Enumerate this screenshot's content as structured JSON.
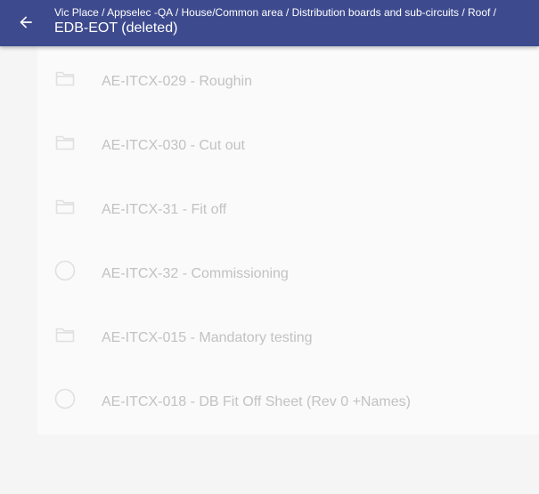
{
  "header": {
    "back_icon": "arrow-left-icon",
    "breadcrumb": "Vic Place / Appselec -QA / House/Common area / Distribution boards and sub-circuits / Roof /",
    "title": "EDB-EOT (deleted)",
    "background_color": "#3d4a8e"
  },
  "list": {
    "items": [
      {
        "icon": "folder-icon",
        "label": "AE-ITCX-029 - Roughin"
      },
      {
        "icon": "folder-icon",
        "label": "AE-ITCX-030 - Cut out"
      },
      {
        "icon": "folder-icon",
        "label": "AE-ITCX-31 - Fit off"
      },
      {
        "icon": "circle-icon",
        "label": "AE-ITCX-32 - Commissioning"
      },
      {
        "icon": "folder-icon",
        "label": "AE-ITCX-015 - Mandatory testing"
      },
      {
        "icon": "circle-icon",
        "label": "AE-ITCX-018 - DB Fit Off Sheet (Rev 0 +Names)"
      }
    ],
    "text_color": "#c2c2c2",
    "icon_color": "#e0e0e0"
  }
}
